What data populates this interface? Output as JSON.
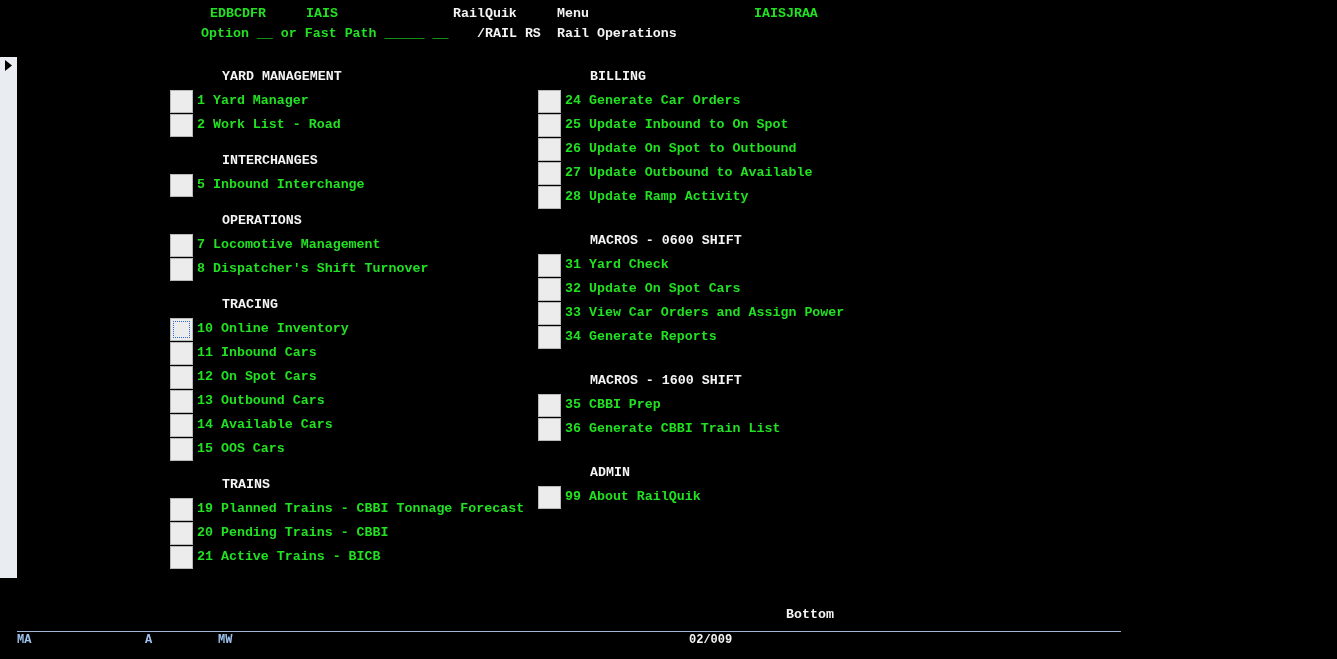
{
  "header": {
    "user": "EDBCDFR",
    "system": "IAIS",
    "app": "RailQuik",
    "screen_type": "Menu",
    "screen_id": "IAISJRAA",
    "option_line": "Option __ or Fast Path _____ __",
    "path": "/RAIL RS",
    "title": "Rail Operations"
  },
  "columns": [
    {
      "sections": [
        {
          "heading": "YARD MANAGEMENT",
          "items": [
            {
              "label": "1 Yard Manager",
              "selected": false
            },
            {
              "label": "2 Work List - Road",
              "selected": false
            }
          ]
        },
        {
          "heading": "INTERCHANGES",
          "items": [
            {
              "label": "5 Inbound Interchange",
              "selected": false
            }
          ]
        },
        {
          "heading": "OPERATIONS",
          "items": [
            {
              "label": "7 Locomotive Management",
              "selected": false
            },
            {
              "label": "8 Dispatcher's Shift Turnover",
              "selected": false
            }
          ]
        },
        {
          "heading": "TRACING",
          "items": [
            {
              "label": "10 Online Inventory",
              "selected": true
            },
            {
              "label": "11 Inbound Cars",
              "selected": false
            },
            {
              "label": "12 On Spot Cars",
              "selected": false
            },
            {
              "label": "13 Outbound Cars",
              "selected": false
            },
            {
              "label": "14 Available Cars",
              "selected": false
            },
            {
              "label": "15 OOS Cars",
              "selected": false
            }
          ]
        },
        {
          "heading": "TRAINS",
          "items": [
            {
              "label": "19 Planned Trains - CBBI Tonnage Forecast",
              "selected": false
            },
            {
              "label": "20 Pending Trains - CBBI",
              "selected": false
            },
            {
              "label": "21 Active Trains - BICB",
              "selected": false
            }
          ]
        }
      ]
    },
    {
      "sections": [
        {
          "heading": "BILLING",
          "items": [
            {
              "label": "24 Generate Car Orders",
              "selected": false
            },
            {
              "label": "25 Update Inbound to On Spot",
              "selected": false
            },
            {
              "label": "26 Update On Spot to Outbound",
              "selected": false
            },
            {
              "label": "27 Update Outbound to Available",
              "selected": false
            },
            {
              "label": "28 Update Ramp Activity",
              "selected": false
            }
          ]
        },
        {
          "heading": "MACROS - 0600 SHIFT",
          "items": [
            {
              "label": "31 Yard Check",
              "selected": false
            },
            {
              "label": "32 Update On Spot Cars",
              "selected": false
            },
            {
              "label": "33 View Car Orders and Assign Power",
              "selected": false
            },
            {
              "label": "34 Generate Reports",
              "selected": false
            }
          ]
        },
        {
          "heading": "MACROS - 1600 SHIFT",
          "items": [
            {
              "label": "35 CBBI Prep",
              "selected": false
            },
            {
              "label": "36 Generate CBBI Train List",
              "selected": false
            }
          ]
        },
        {
          "heading": "ADMIN",
          "items": [
            {
              "label": "99 About RailQuik",
              "selected": false
            }
          ]
        }
      ]
    }
  ],
  "scroll_indicator": "Bottom",
  "status_bar": {
    "field_1": "MA",
    "field_2": "A",
    "field_3": "MW",
    "page": "02/009"
  }
}
